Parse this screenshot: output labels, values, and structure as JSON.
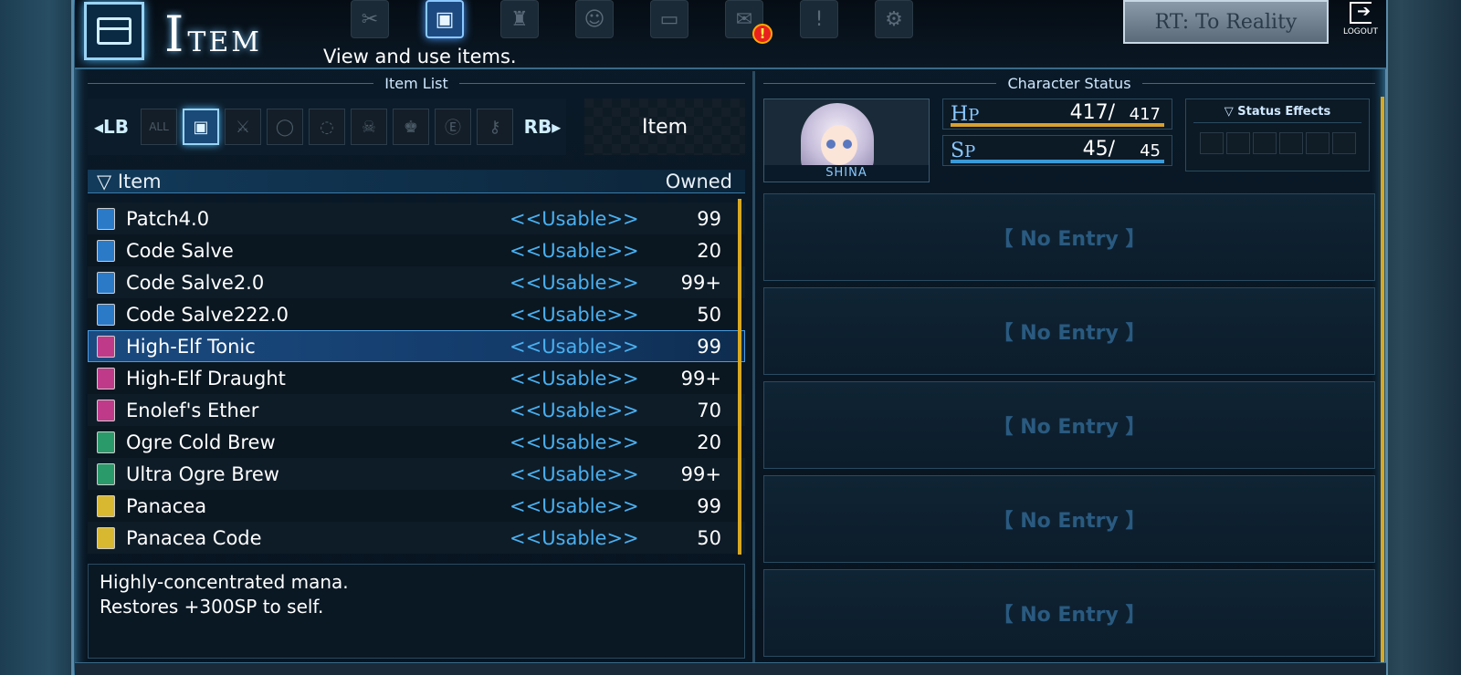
{
  "header": {
    "title_initial": "I",
    "title_rest": "TEM",
    "subtitle": "View and use items.",
    "nav_icons": [
      {
        "name": "skills-icon",
        "glyph": "✂"
      },
      {
        "name": "item-icon",
        "glyph": "▣",
        "active": true
      },
      {
        "name": "equip-icon",
        "glyph": "♜"
      },
      {
        "name": "party-icon",
        "glyph": "☺"
      },
      {
        "name": "system-icon",
        "glyph": "▭"
      },
      {
        "name": "library-icon",
        "glyph": "✉"
      },
      {
        "name": "notice-icon",
        "glyph": "!"
      },
      {
        "name": "settings-icon",
        "glyph": "⚙"
      }
    ],
    "alert_badge": "!",
    "rt_button": "RT: To Reality",
    "logout_label": "LOGOUT"
  },
  "item_list_label": "Item List",
  "character_status_label": "Character Status",
  "categories": {
    "lb": "◂LB",
    "rb": "RB▸",
    "tabs": [
      {
        "label": "ALL",
        "name": "all",
        "txt": true
      },
      {
        "label": "▣",
        "name": "item",
        "active": true
      },
      {
        "label": "⚔",
        "name": "weapon"
      },
      {
        "label": "◯",
        "name": "ring"
      },
      {
        "label": "◌",
        "name": "amulet"
      },
      {
        "label": "☠",
        "name": "skull"
      },
      {
        "label": "♚",
        "name": "armor"
      },
      {
        "label": "Ⓔ",
        "name": "event"
      },
      {
        "label": "⚷",
        "name": "key"
      }
    ],
    "current": "Item"
  },
  "list_header": {
    "item": "▽ Item",
    "owned": "Owned"
  },
  "items": [
    {
      "name": "Patch4.0",
      "status": "<<Usable>>",
      "owned": "99",
      "color": "blue"
    },
    {
      "name": "Code Salve",
      "status": "<<Usable>>",
      "owned": "20",
      "color": "blue"
    },
    {
      "name": "Code Salve2.0",
      "status": "<<Usable>>",
      "owned": "99+",
      "color": "blue"
    },
    {
      "name": "Code Salve222.0",
      "status": "<<Usable>>",
      "owned": "50",
      "color": "blue"
    },
    {
      "name": "High-Elf Tonic",
      "status": "<<Usable>>",
      "owned": "99",
      "color": "pink",
      "selected": true
    },
    {
      "name": "High-Elf Draught",
      "status": "<<Usable>>",
      "owned": "99+",
      "color": "pink"
    },
    {
      "name": "Enolef's Ether",
      "status": "<<Usable>>",
      "owned": "70",
      "color": "pink"
    },
    {
      "name": "Ogre Cold Brew",
      "status": "<<Usable>>",
      "owned": "20",
      "color": "green"
    },
    {
      "name": "Ultra Ogre Brew",
      "status": "<<Usable>>",
      "owned": "99+",
      "color": "green"
    },
    {
      "name": "Panacea",
      "status": "<<Usable>>",
      "owned": "99",
      "color": "yellow"
    },
    {
      "name": "Panacea Code",
      "status": "<<Usable>>",
      "owned": "50",
      "color": "yellow"
    }
  ],
  "description": {
    "line1": "Highly-concentrated mana.",
    "line2": "Restores +300SP to self."
  },
  "character": {
    "name": "SHINA",
    "hp": {
      "cap": "H",
      "rest": "P",
      "current": "417/",
      "max": "417",
      "fraction": 1.0,
      "color": "#d8a030"
    },
    "sp": {
      "cap": "S",
      "rest": "P",
      "current": "45/",
      "max": "45",
      "fraction": 1.0,
      "color": "#3a9ad8"
    },
    "status_effects_label": "▽ Status Effects",
    "status_slots": 6
  },
  "entries": [
    "【 No Entry 】",
    "【 No Entry 】",
    "【 No Entry 】",
    "【 No Entry 】",
    "【 No Entry 】"
  ]
}
